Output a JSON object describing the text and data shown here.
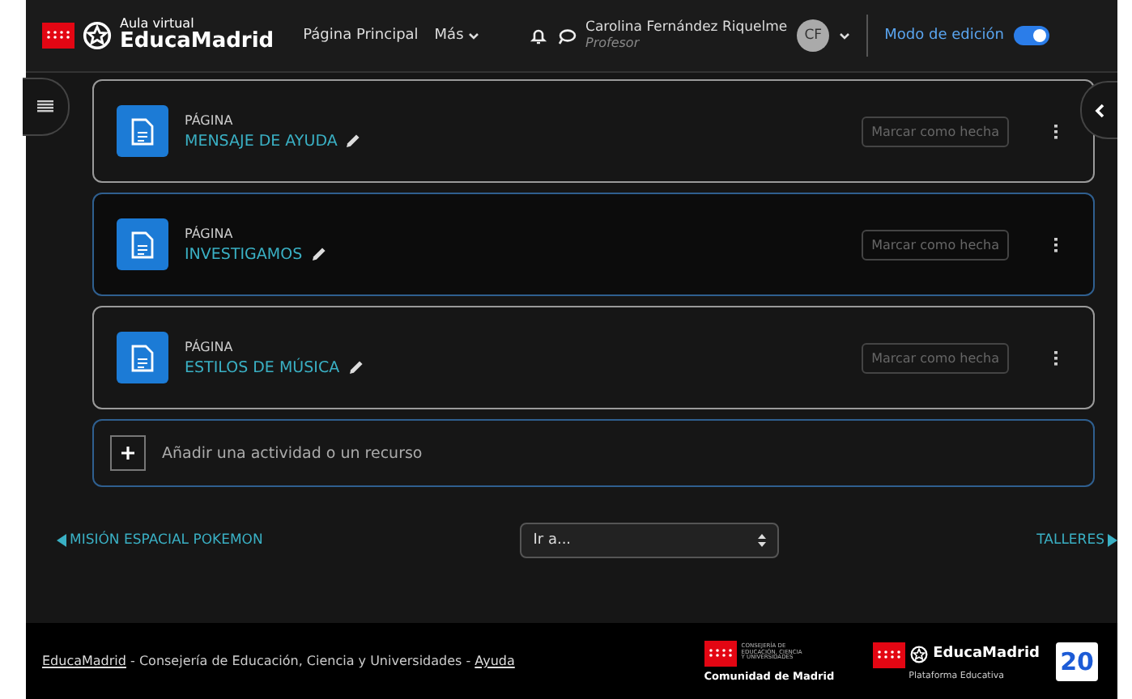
{
  "header": {
    "brand_top": "Aula virtual",
    "brand": "EducaMadrid",
    "nav": [
      {
        "label": "Página Principal",
        "dropdown": false
      },
      {
        "label": "Más",
        "dropdown": true
      }
    ],
    "user": {
      "name": "Carolina Fernández Riquelme",
      "role": "Profesor",
      "initials": "CF"
    },
    "edit_mode": {
      "label": "Modo de edición",
      "on": true
    }
  },
  "activities": [
    {
      "type": "PÁGINA",
      "title": "MENSAJE DE AYUDA",
      "highlighted": false,
      "completion": "Marcar como hecha"
    },
    {
      "type": "PÁGINA",
      "title": "INVESTIGAMOS",
      "highlighted": true,
      "completion": "Marcar como hecha"
    },
    {
      "type": "PÁGINA",
      "title": "ESTILOS DE MÚSICA",
      "highlighted": false,
      "completion": "Marcar como hecha"
    }
  ],
  "add_activity": "Añadir una actividad o un recurso",
  "navigation": {
    "previous": "MISIÓN ESPACIAL POKEMON",
    "jump": "Ir a...",
    "next": "TALLERES"
  },
  "footer": {
    "brand_link": "EducaMadrid",
    "text": " - Consejería de Educación, Ciencia y Universidades - ",
    "help_link": "Ayuda",
    "logos": [
      {
        "top": "CONSEJERÍA DE EDUCACIÓN, CIENCIA Y UNIVERSIDADES",
        "bottom": "Comunidad de Madrid"
      },
      {
        "top": "EducaMadrid",
        "bottom": "Plataforma Educativa"
      }
    ],
    "badge": "20"
  }
}
